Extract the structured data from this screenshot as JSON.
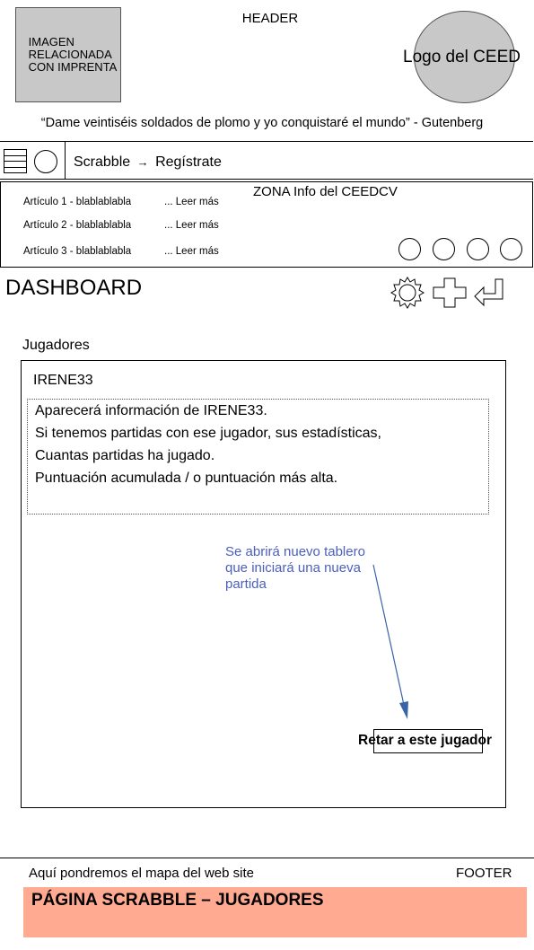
{
  "header": {
    "label": "HEADER",
    "image_placeholder": "IMAGEN\nRELACIONADA\nCON IMPRENTA",
    "logo_text": "Logo del CEED",
    "quote": "“Dame veintiséis soldados de plomo y yo conquistaré el mundo”  - Gutenberg"
  },
  "nav": {
    "breadcrumb_home": "Scrabble",
    "breadcrumb_sep": "→",
    "breadcrumb_current": "Regístrate",
    "icons": [
      "menu-icon",
      "circle-icon"
    ]
  },
  "info_zone": {
    "title": "ZONA Info del CEEDCV",
    "articles": [
      {
        "title": "Artículo 1 - blablablabla",
        "link": "... Leer más"
      },
      {
        "title": "Artículo 2 - blablablabla",
        "link": "... Leer más"
      },
      {
        "title": "Artículo 3 - blablablabla",
        "link": "... Leer más"
      }
    ],
    "circle_count": 4
  },
  "dashboard": {
    "title": "DASHBOARD",
    "icons": [
      "gear-icon",
      "plus-icon",
      "return-icon"
    ]
  },
  "players": {
    "section_label": "Jugadores",
    "player_name": "IRENE33",
    "info_lines": [
      "Aparecerá información de IRENE33.",
      "Si tenemos partidas con ese jugador, sus estadísticas,",
      "Cuantas partidas ha jugado.",
      "Puntuación acumulada / o puntuación más alta."
    ],
    "annotation": "Se abrirá nuevo tablero\nque iniciará una nueva\npartida",
    "challenge_button": "Retar a este jugador"
  },
  "footer": {
    "sitemap_text": "Aquí pondremos el mapa del web site",
    "label": "FOOTER",
    "page_title": "PÁGINA SCRABBLE – JUGADORES"
  },
  "colors": {
    "placeholder_gray": "#c8c8c8",
    "annotation_blue": "#4a5fbf",
    "footer_band": "#ffaa91"
  }
}
